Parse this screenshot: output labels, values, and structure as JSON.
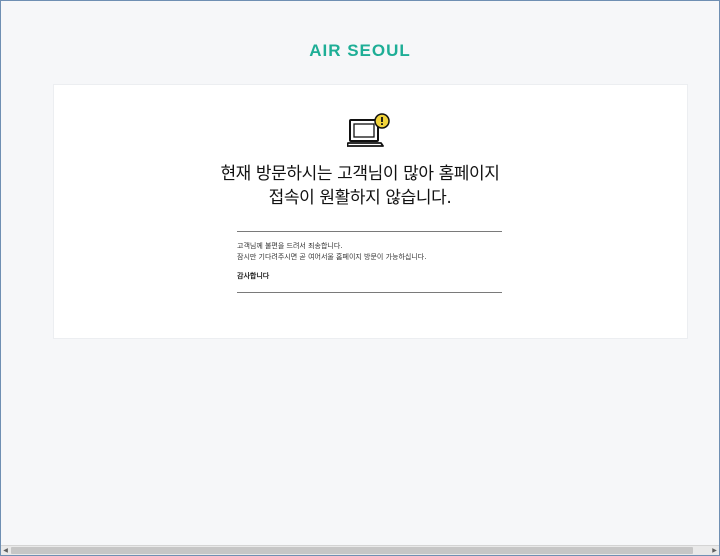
{
  "brand": {
    "logo_text": "AIR SEOUL",
    "accent_color": "#1eae96"
  },
  "notice": {
    "icon": "laptop-warning-icon",
    "headline_line1": "현재 방문하시는 고객님이 많아 홈페이지",
    "headline_line2": "접속이 원활하지 않습니다.",
    "message_line1": "고객님께 불편을 드려서 죄송합니다.",
    "message_line2": "잠시만 기다려주시면 곧 여어서울 홈페이지 방문이 가능하십니다.",
    "thanks": "감사합니다"
  },
  "scrollbar": {
    "left_arrow": "◀",
    "right_arrow": "▶"
  }
}
